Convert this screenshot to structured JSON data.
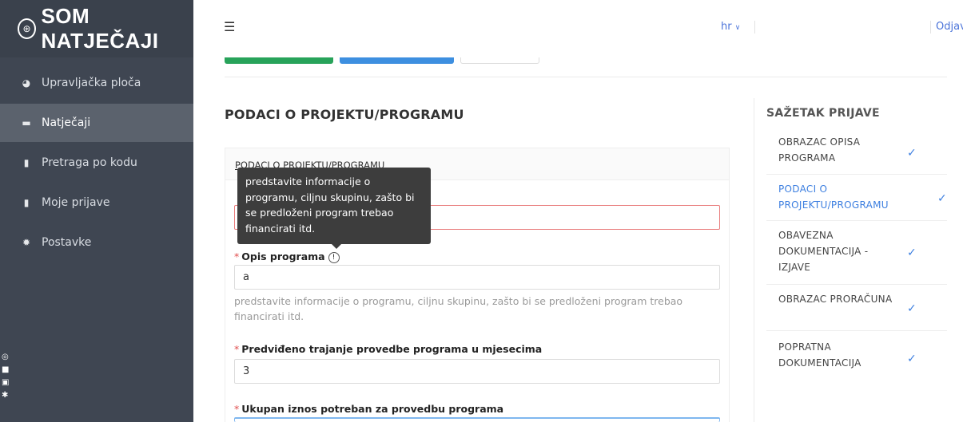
{
  "app": {
    "logo_text": "SOM NATJEČAJI"
  },
  "sidebar": {
    "items": [
      {
        "label": "Upravljačka ploča",
        "icon": "pie-chart-icon"
      },
      {
        "label": "Natječaji",
        "icon": "folder-open-icon"
      },
      {
        "label": "Pretraga po kodu",
        "icon": "file-icon"
      },
      {
        "label": "Moje prijave",
        "icon": "document-icon"
      },
      {
        "label": "Postavke",
        "icon": "gear-icon"
      }
    ],
    "active_index": 1
  },
  "topbar": {
    "language": "hr",
    "logout": "Odjava"
  },
  "main": {
    "section_title": "PODACI O PROJEKTU/PROGRAMU",
    "card_title": "PODACI O PROJEKTU/PROGRAMU",
    "tooltip": "predstavite informacije o programu, ciljnu skupinu, zašto bi se predloženi program trebao financirati itd.",
    "fields": [
      {
        "label": "Opis programa",
        "value": "a",
        "hint": "predstavite informacije o programu, ciljnu skupinu, zašto bi se predloženi program trebao financirati itd."
      },
      {
        "label": "Predviđeno trajanje provedbe programa u mjesecima",
        "value": "3"
      },
      {
        "label": "Ukupan iznos potreban za provedbu programa",
        "value": ""
      }
    ]
  },
  "summary": {
    "title": "SAŽETAK PRIJAVE",
    "items": [
      {
        "label": "OBRAZAC OPISA PROGRAMA",
        "status": "complete"
      },
      {
        "label": "PODACI O PROJEKTU/PROGRAMU",
        "status": "complete"
      },
      {
        "label": "OBAVEZNA DOKUMENTACIJA - IZJAVE",
        "status": "complete"
      },
      {
        "label": "OBRAZAC PRORAČUNA",
        "status": "complete"
      },
      {
        "label": "POPRATNA DOKUMENTACIJA",
        "status": "complete"
      }
    ],
    "check_glyph": "✓"
  },
  "colors": {
    "sidebar_bg": "#3f4652",
    "accent": "#3d7fe0",
    "required": "#e04e4e"
  }
}
